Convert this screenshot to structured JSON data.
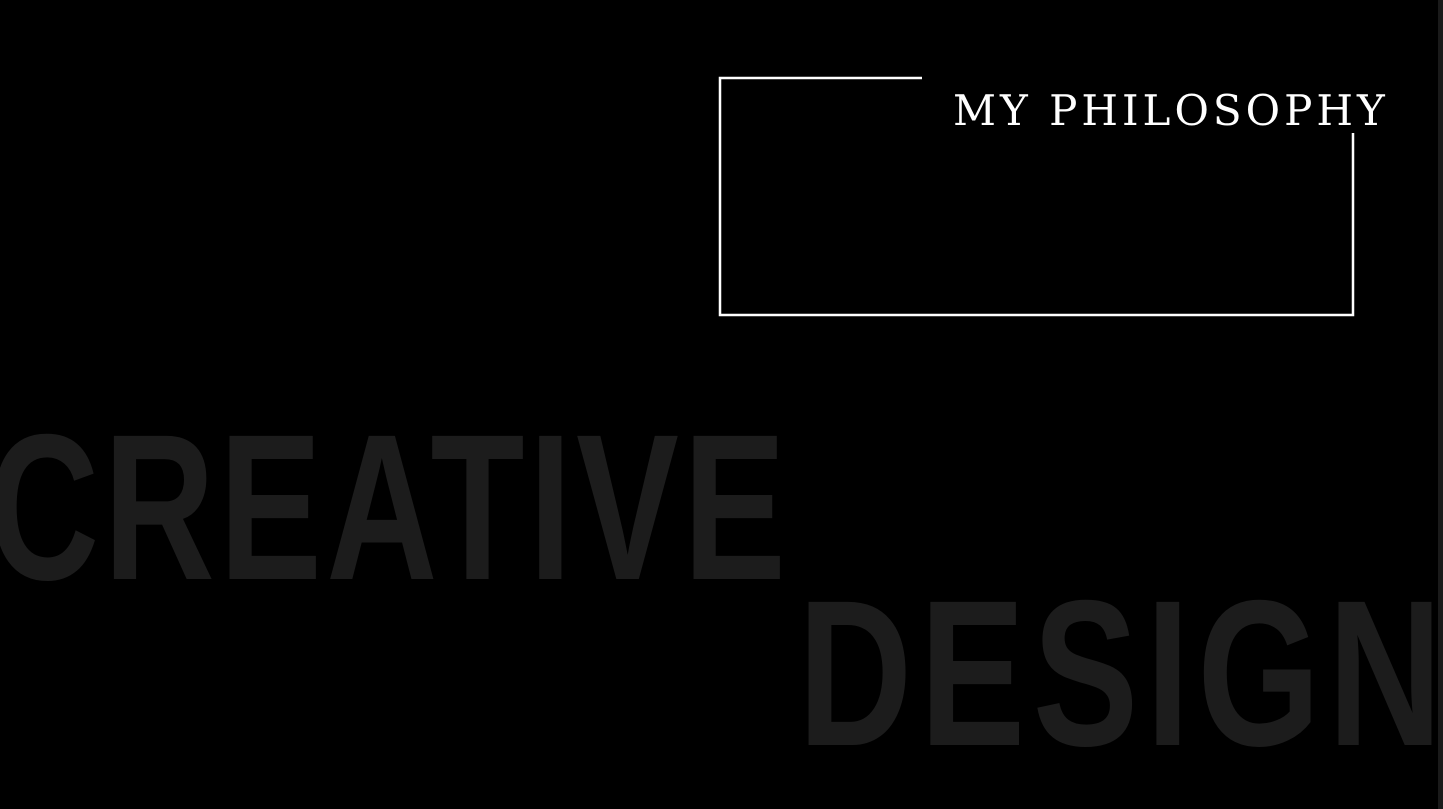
{
  "section": {
    "title": "MY PHILOSOPHY"
  },
  "background_words": {
    "first": "CREATIVE",
    "second": "DESIGN"
  },
  "colors": {
    "background": "#000000",
    "title": "#ffffff",
    "frame": "#ffffff",
    "background_words": "#1c1c1c"
  }
}
